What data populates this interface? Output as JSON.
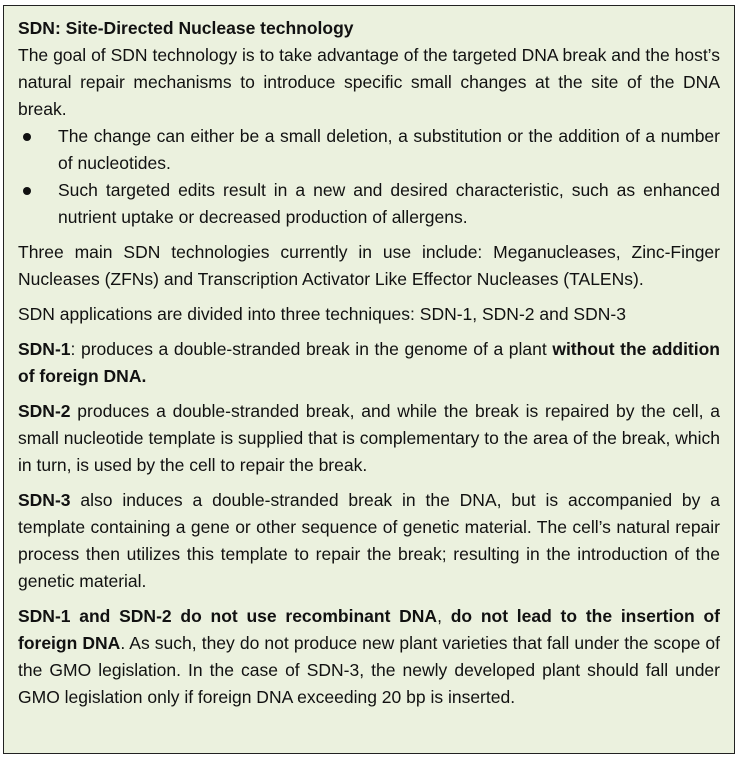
{
  "title": "SDN: Site-Directed Nuclease technology",
  "intro": "The goal of SDN technology is to take advantage of the targeted DNA break and the host’s natural repair mechanisms to introduce specific small changes at the site of the DNA break.",
  "bullets": [
    "The change can either be a small deletion, a substitution or the addition of a number of nucleotides.",
    "Such targeted edits result in a new and desired characteristic, such as enhanced nutrient uptake or decreased production of allergens."
  ],
  "technologies": "Three main SDN technologies currently in use include: Meganucleases, Zinc-Finger Nucleases (ZFNs) and Transcription Activator Like Effector Nucleases (TALENs).",
  "applications": "SDN applications are divided into three techniques: SDN-1, SDN-2 and SDN-3",
  "sdn1": {
    "label": "SDN-1",
    "text": ": produces a double-stranded break in the genome of a plant ",
    "bold_tail": "without the addition of foreign DNA."
  },
  "sdn2": {
    "label": "SDN-2",
    "text": " produces a double-stranded break, and while the break is repaired by the cell, a small nucleotide template is supplied that is complementary to the area of the break, which in turn, is used by the cell to repair the break."
  },
  "sdn3": {
    "label": "SDN-3",
    "text": " also induces a double-stranded break in the DNA, but is accompanied by a template containing a gene or other sequence of genetic material. The cell’s natural repair process then utilizes this template to repair the break; resulting in the introduction of the genetic material."
  },
  "conclusion": {
    "bold1": "SDN-1 and SDN-2 do not use recombinant DNA",
    "sep": ", ",
    "bold2": "do not lead to the insertion of foreign DNA",
    "text": ". As such, they do not produce new plant varieties that fall under the scope of the GMO legislation. In the case of SDN-3, the newly developed plant should fall under GMO legislation only if foreign DNA exceeding 20 bp is inserted."
  }
}
